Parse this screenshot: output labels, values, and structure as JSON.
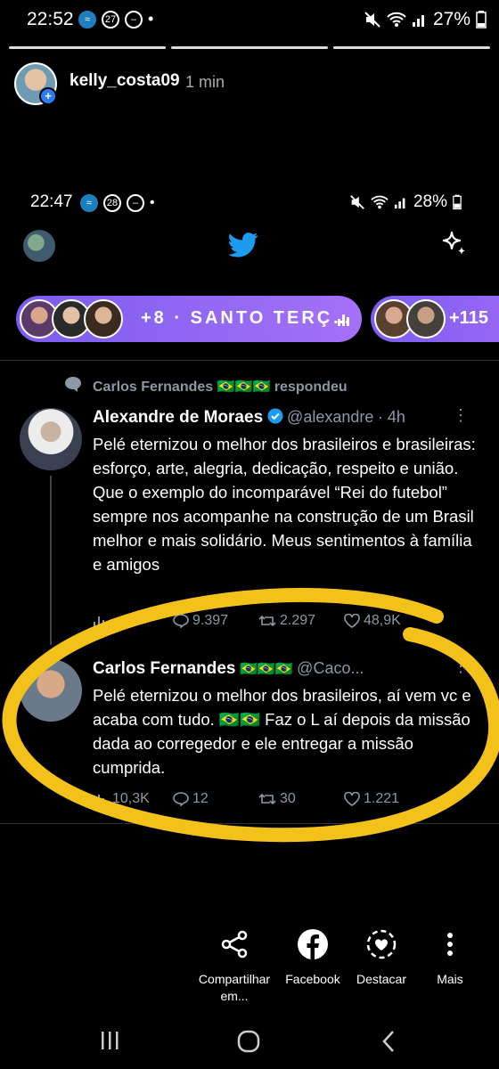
{
  "statusbar": {
    "time": "22:52",
    "badge": "27",
    "battery": "27%"
  },
  "story": {
    "username": "kelly_costa09",
    "time": "1 min"
  },
  "inner_status": {
    "time": "22:47",
    "badge": "28",
    "battery": "28%"
  },
  "spaces": {
    "count": "+8",
    "separator": "·",
    "title": "SANTO TERÇ…",
    "count2": "+115"
  },
  "replied": {
    "name": "Carlos Fernandes",
    "suffix": "respondeu"
  },
  "tweet1": {
    "name": "Alexandre de Moraes",
    "handle": "@alexandre",
    "time": "· 4h",
    "body": "Pelé eternizou o melhor dos brasileiros e brasileiras: esforço, arte, alegria, dedicação, respeito e união. Que o exemplo do incomparável “Rei do futebol” sempre nos acompanhe na construção de um Brasil melhor e mais solidário. Meus sentimentos à família e amigos",
    "replies": "9.397",
    "retweets": "2.297",
    "likes": "48,9K"
  },
  "tweet2": {
    "name": "Carlos Fernandes",
    "handle": "@Caco...",
    "body1": "Pelé eternizou o melhor dos brasileiros, aí vem vc e acaba com tudo.",
    "body2": "Faz o L aí depois da missão dada ao corregedor e ele entregar a missão cumprida.",
    "views": "10,3K",
    "replies": "12",
    "retweets": "30",
    "likes": "1.221"
  },
  "share": {
    "share_label": "Compartilhar em...",
    "facebook_label": "Facebook",
    "highlight_label": "Destacar",
    "more_label": "Mais"
  },
  "colors": {
    "twitter_blue": "#1d9bf0",
    "spaces_purple": "#8a63f2",
    "highlight_yellow": "#f2c21b"
  }
}
